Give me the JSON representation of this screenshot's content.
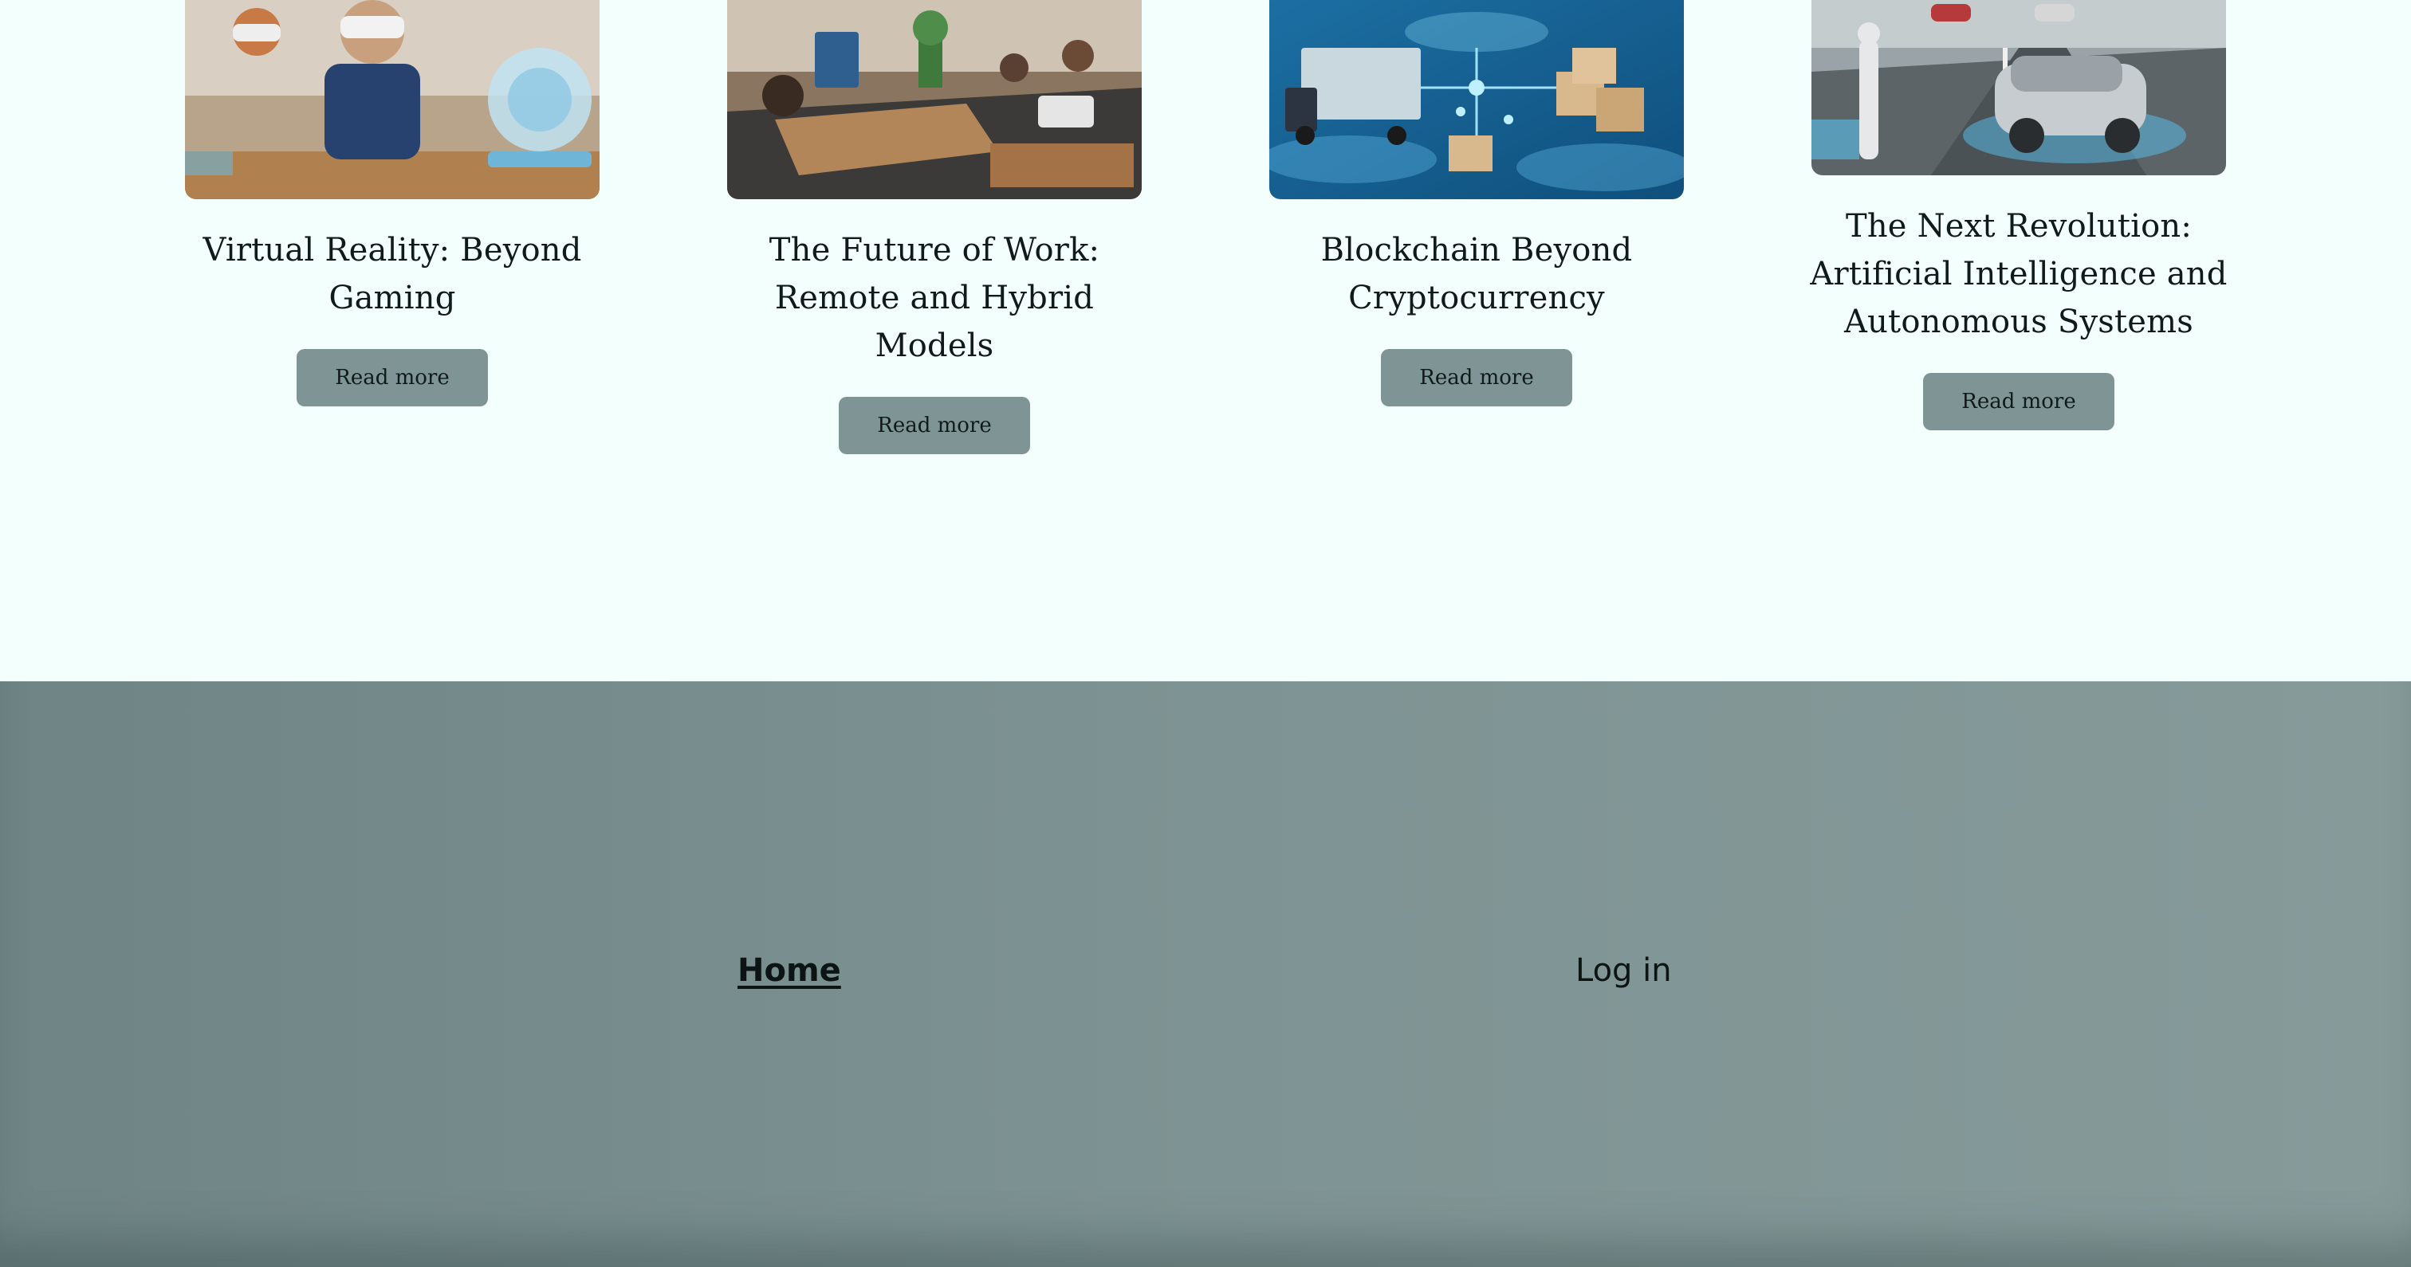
{
  "posts": [
    {
      "title": "Virtual Reality: Beyond Gaming",
      "button": "Read more",
      "image_icon": "vr-classroom-image"
    },
    {
      "title": "The Future of Work: Remote and Hybrid Models",
      "button": "Read more",
      "image_icon": "office-workspace-image"
    },
    {
      "title": "Blockchain Beyond Cryptocurrency",
      "button": "Read more",
      "image_icon": "blockchain-logistics-image"
    },
    {
      "title": "The Next Revolution: Artificial Intelligence and Autonomous Systems",
      "button": "Read more",
      "image_icon": "autonomous-car-image"
    }
  ],
  "footer": {
    "home": "Home",
    "login": "Log in"
  },
  "colors": {
    "page_background": "#f3fffc",
    "button_background": "#7f9595",
    "footer_background": "#7e9393",
    "text": "#111a1a"
  }
}
